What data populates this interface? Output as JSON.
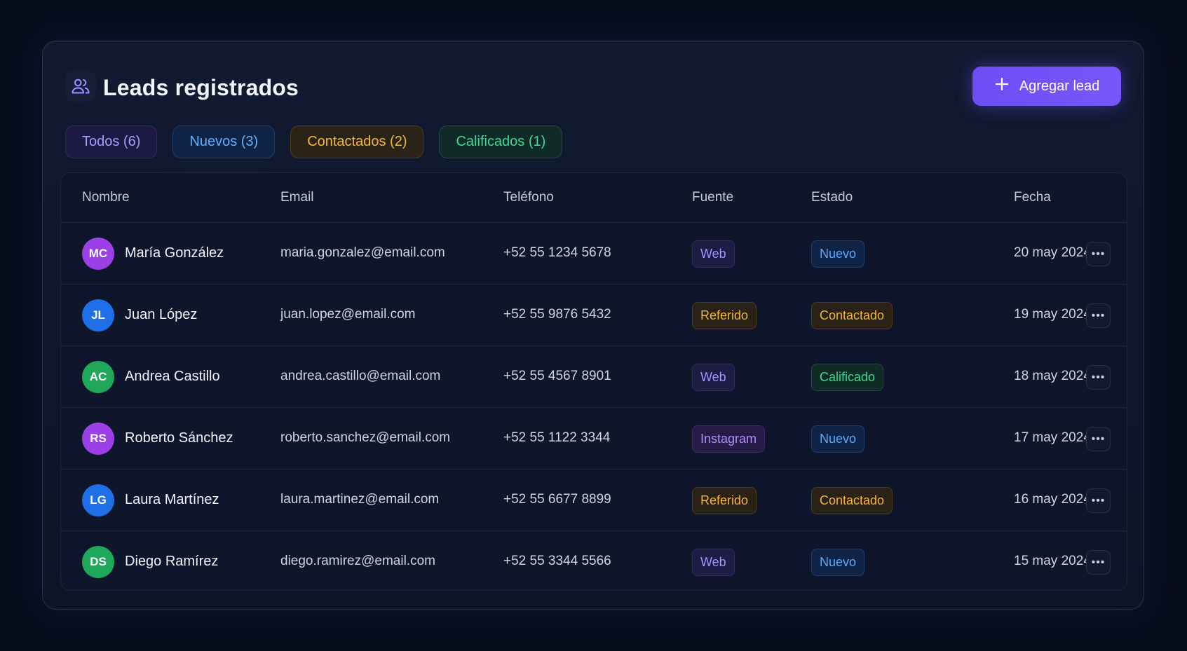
{
  "header": {
    "title": "Leads registrados",
    "icon": "users-icon",
    "add_button": {
      "label": "Agregar lead",
      "icon": "plus-icon"
    }
  },
  "tabs": [
    {
      "label": "Todos (6)",
      "variant": "todos",
      "color": "#a99bff"
    },
    {
      "label": "Nuevos (3)",
      "variant": "nuevos",
      "color": "#5fb0ff"
    },
    {
      "label": "Contactados (2)",
      "variant": "contactados",
      "color": "#f5b93a"
    },
    {
      "label": "Calificados (1)",
      "variant": "calificados",
      "color": "#3fd894"
    }
  ],
  "table": {
    "columns": [
      "Nombre",
      "Email",
      "Teléfono",
      "Fuente",
      "Estado",
      "Fecha"
    ],
    "rows": [
      {
        "initials": "MC",
        "avatar_color": "#9b3fe6",
        "name": "María González",
        "email": "maria.gonzalez@email.com",
        "phone": "+52 55 1234 5678",
        "source": "Web",
        "source_variant": "web",
        "status": "Nuevo",
        "status_variant": "nuevo",
        "date": "20 may 2024"
      },
      {
        "initials": "JL",
        "avatar_color": "#1f6fe8",
        "name": "Juan López",
        "email": "juan.lopez@email.com",
        "phone": "+52 55 9876 5432",
        "source": "Referido",
        "source_variant": "referido",
        "status": "Contactado",
        "status_variant": "contactado",
        "date": "19 may 2024"
      },
      {
        "initials": "AC",
        "avatar_color": "#1fa85a",
        "name": "Andrea Castillo",
        "email": "andrea.castillo@email.com",
        "phone": "+52 55 4567 8901",
        "source": "Web",
        "source_variant": "web",
        "status": "Calificado",
        "status_variant": "calificado",
        "date": "18 may 2024"
      },
      {
        "initials": "RS",
        "avatar_color": "#9b3fe6",
        "name": "Roberto Sánchez",
        "email": "roberto.sanchez@email.com",
        "phone": "+52 55 1122 3344",
        "source": "Instagram",
        "source_variant": "instagram",
        "status": "Nuevo",
        "status_variant": "nuevo",
        "date": "17 may 2024"
      },
      {
        "initials": "LG",
        "avatar_color": "#1f6fe8",
        "name": "Laura Martínez",
        "email": "laura.martinez@email.com",
        "phone": "+52 55 6677 8899",
        "source": "Referido",
        "source_variant": "referido",
        "status": "Contactado",
        "status_variant": "contactado",
        "date": "16 may 2024"
      },
      {
        "initials": "DS",
        "avatar_color": "#1fa85a",
        "name": "Diego Ramírez",
        "email": "diego.ramirez@email.com",
        "phone": "+52 55 3344 5566",
        "source": "Web",
        "source_variant": "web",
        "status": "Nuevo",
        "status_variant": "nuevo",
        "date": "15 may 2024"
      }
    ],
    "row_action_icon": "more-horizontal-icon"
  },
  "colors": {
    "background": "#080d1e",
    "card": "#111a31",
    "accent": "#6d4ef5"
  }
}
